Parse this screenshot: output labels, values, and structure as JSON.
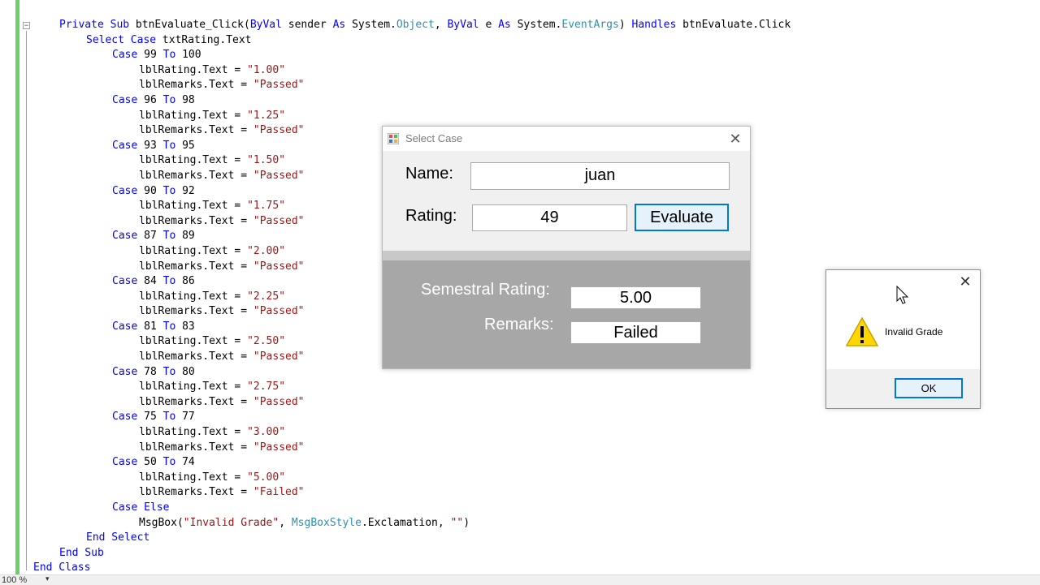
{
  "editor": {
    "zoom": "100 %",
    "lines": [
      {
        "indent": 0,
        "tokens": [
          {
            "t": "Private Sub ",
            "c": "kw"
          },
          {
            "t": "btnEvaluate_Click(",
            "c": "tx"
          },
          {
            "t": "ByVal ",
            "c": "kw"
          },
          {
            "t": "sender ",
            "c": "tx"
          },
          {
            "t": "As ",
            "c": "kw"
          },
          {
            "t": "System.",
            "c": "tx"
          },
          {
            "t": "Object",
            "c": "ty"
          },
          {
            "t": ", ",
            "c": "tx"
          },
          {
            "t": "ByVal ",
            "c": "kw"
          },
          {
            "t": "e ",
            "c": "tx"
          },
          {
            "t": "As ",
            "c": "kw"
          },
          {
            "t": "System.",
            "c": "tx"
          },
          {
            "t": "EventArgs",
            "c": "ty"
          },
          {
            "t": ") ",
            "c": "tx"
          },
          {
            "t": "Handles ",
            "c": "kw"
          },
          {
            "t": "btnEvaluate.Click",
            "c": "tx"
          }
        ]
      },
      {
        "indent": 1,
        "tokens": [
          {
            "t": "Select Case ",
            "c": "kw"
          },
          {
            "t": "txtRating.Text",
            "c": "tx"
          }
        ]
      },
      {
        "indent": 2,
        "tokens": [
          {
            "t": "Case ",
            "c": "kw"
          },
          {
            "t": "99 ",
            "c": "tx"
          },
          {
            "t": "To ",
            "c": "kw"
          },
          {
            "t": "100",
            "c": "tx"
          }
        ]
      },
      {
        "indent": 3,
        "tokens": [
          {
            "t": "lblRating.Text = ",
            "c": "tx"
          },
          {
            "t": "\"1.00\"",
            "c": "st"
          }
        ]
      },
      {
        "indent": 3,
        "tokens": [
          {
            "t": "lblRemarks.Text = ",
            "c": "tx"
          },
          {
            "t": "\"Passed\"",
            "c": "st"
          }
        ]
      },
      {
        "indent": 2,
        "tokens": [
          {
            "t": "Case ",
            "c": "kw"
          },
          {
            "t": "96 ",
            "c": "tx"
          },
          {
            "t": "To ",
            "c": "kw"
          },
          {
            "t": "98",
            "c": "tx"
          }
        ]
      },
      {
        "indent": 3,
        "tokens": [
          {
            "t": "lblRating.Text = ",
            "c": "tx"
          },
          {
            "t": "\"1.25\"",
            "c": "st"
          }
        ]
      },
      {
        "indent": 3,
        "tokens": [
          {
            "t": "lblRemarks.Text = ",
            "c": "tx"
          },
          {
            "t": "\"Passed\"",
            "c": "st"
          }
        ]
      },
      {
        "indent": 2,
        "tokens": [
          {
            "t": "Case ",
            "c": "kw"
          },
          {
            "t": "93 ",
            "c": "tx"
          },
          {
            "t": "To ",
            "c": "kw"
          },
          {
            "t": "95",
            "c": "tx"
          }
        ]
      },
      {
        "indent": 3,
        "tokens": [
          {
            "t": "lblRating.Text = ",
            "c": "tx"
          },
          {
            "t": "\"1.50\"",
            "c": "st"
          }
        ]
      },
      {
        "indent": 3,
        "tokens": [
          {
            "t": "lblRemarks.Text = ",
            "c": "tx"
          },
          {
            "t": "\"Passed\"",
            "c": "st"
          }
        ]
      },
      {
        "indent": 2,
        "tokens": [
          {
            "t": "Case ",
            "c": "kw"
          },
          {
            "t": "90 ",
            "c": "tx"
          },
          {
            "t": "To ",
            "c": "kw"
          },
          {
            "t": "92",
            "c": "tx"
          }
        ]
      },
      {
        "indent": 3,
        "tokens": [
          {
            "t": "lblRating.Text = ",
            "c": "tx"
          },
          {
            "t": "\"1.75\"",
            "c": "st"
          }
        ]
      },
      {
        "indent": 3,
        "tokens": [
          {
            "t": "lblRemarks.Text = ",
            "c": "tx"
          },
          {
            "t": "\"Passed\"",
            "c": "st"
          }
        ]
      },
      {
        "indent": 2,
        "tokens": [
          {
            "t": "Case ",
            "c": "kw"
          },
          {
            "t": "87 ",
            "c": "tx"
          },
          {
            "t": "To ",
            "c": "kw"
          },
          {
            "t": "89",
            "c": "tx"
          }
        ]
      },
      {
        "indent": 3,
        "tokens": [
          {
            "t": "lblRating.Text = ",
            "c": "tx"
          },
          {
            "t": "\"2.00\"",
            "c": "st"
          }
        ]
      },
      {
        "indent": 3,
        "tokens": [
          {
            "t": "lblRemarks.Text = ",
            "c": "tx"
          },
          {
            "t": "\"Passed\"",
            "c": "st"
          }
        ]
      },
      {
        "indent": 2,
        "tokens": [
          {
            "t": "Case ",
            "c": "kw"
          },
          {
            "t": "84 ",
            "c": "tx"
          },
          {
            "t": "To ",
            "c": "kw"
          },
          {
            "t": "86",
            "c": "tx"
          }
        ]
      },
      {
        "indent": 3,
        "tokens": [
          {
            "t": "lblRating.Text = ",
            "c": "tx"
          },
          {
            "t": "\"2.25\"",
            "c": "st"
          }
        ]
      },
      {
        "indent": 3,
        "tokens": [
          {
            "t": "lblRemarks.Text = ",
            "c": "tx"
          },
          {
            "t": "\"Passed\"",
            "c": "st"
          }
        ]
      },
      {
        "indent": 2,
        "tokens": [
          {
            "t": "Case ",
            "c": "kw"
          },
          {
            "t": "81 ",
            "c": "tx"
          },
          {
            "t": "To ",
            "c": "kw"
          },
          {
            "t": "83",
            "c": "tx"
          }
        ]
      },
      {
        "indent": 3,
        "tokens": [
          {
            "t": "lblRating.Text = ",
            "c": "tx"
          },
          {
            "t": "\"2.50\"",
            "c": "st"
          }
        ]
      },
      {
        "indent": 3,
        "tokens": [
          {
            "t": "lblRemarks.Text = ",
            "c": "tx"
          },
          {
            "t": "\"Passed\"",
            "c": "st"
          }
        ]
      },
      {
        "indent": 2,
        "tokens": [
          {
            "t": "Case ",
            "c": "kw"
          },
          {
            "t": "78 ",
            "c": "tx"
          },
          {
            "t": "To ",
            "c": "kw"
          },
          {
            "t": "80",
            "c": "tx"
          }
        ]
      },
      {
        "indent": 3,
        "tokens": [
          {
            "t": "lblRating.Text = ",
            "c": "tx"
          },
          {
            "t": "\"2.75\"",
            "c": "st"
          }
        ]
      },
      {
        "indent": 3,
        "tokens": [
          {
            "t": "lblRemarks.Text = ",
            "c": "tx"
          },
          {
            "t": "\"Passed\"",
            "c": "st"
          }
        ]
      },
      {
        "indent": 2,
        "tokens": [
          {
            "t": "Case ",
            "c": "kw"
          },
          {
            "t": "75 ",
            "c": "tx"
          },
          {
            "t": "To ",
            "c": "kw"
          },
          {
            "t": "77",
            "c": "tx"
          }
        ]
      },
      {
        "indent": 3,
        "tokens": [
          {
            "t": "lblRating.Text = ",
            "c": "tx"
          },
          {
            "t": "\"3.00\"",
            "c": "st"
          }
        ]
      },
      {
        "indent": 3,
        "tokens": [
          {
            "t": "lblRemarks.Text = ",
            "c": "tx"
          },
          {
            "t": "\"Passed\"",
            "c": "st"
          }
        ]
      },
      {
        "indent": 2,
        "tokens": [
          {
            "t": "Case ",
            "c": "kw"
          },
          {
            "t": "50 ",
            "c": "tx"
          },
          {
            "t": "To ",
            "c": "kw"
          },
          {
            "t": "74",
            "c": "tx"
          }
        ]
      },
      {
        "indent": 3,
        "tokens": [
          {
            "t": "lblRating.Text = ",
            "c": "tx"
          },
          {
            "t": "\"5.00\"",
            "c": "st"
          }
        ]
      },
      {
        "indent": 3,
        "tokens": [
          {
            "t": "lblRemarks.Text = ",
            "c": "tx"
          },
          {
            "t": "\"Failed\"",
            "c": "st"
          }
        ]
      },
      {
        "indent": 2,
        "tokens": [
          {
            "t": "Case Else",
            "c": "kw"
          }
        ]
      },
      {
        "indent": 3,
        "tokens": [
          {
            "t": "MsgBox(",
            "c": "tx"
          },
          {
            "t": "\"Invalid Grade\"",
            "c": "st"
          },
          {
            "t": ", ",
            "c": "tx"
          },
          {
            "t": "MsgBoxStyle",
            "c": "ty"
          },
          {
            "t": ".Exclamation, ",
            "c": "tx"
          },
          {
            "t": "\"\"",
            "c": "st"
          },
          {
            "t": ")",
            "c": "tx"
          }
        ]
      },
      {
        "indent": 1,
        "tokens": [
          {
            "t": "End Select",
            "c": "kw"
          }
        ]
      },
      {
        "indent": 0,
        "tokens": [
          {
            "t": "End Sub",
            "c": "kw"
          }
        ]
      },
      {
        "indent": -1,
        "tokens": [
          {
            "t": "End Class",
            "c": "kw"
          }
        ]
      }
    ]
  },
  "form": {
    "title": "Select Case",
    "name_label": "Name:",
    "name_value": "juan",
    "rating_label": "Rating:",
    "rating_value": "49",
    "evaluate_label": "Evaluate",
    "semestral_label": "Semestral Rating:",
    "semestral_value": "5.00",
    "remarks_label": "Remarks:",
    "remarks_value": "Failed",
    "close_glyph": "✕"
  },
  "msgbox": {
    "text": "Invalid Grade",
    "ok_label": "OK",
    "close_glyph": "✕",
    "icon": "warning-icon"
  }
}
